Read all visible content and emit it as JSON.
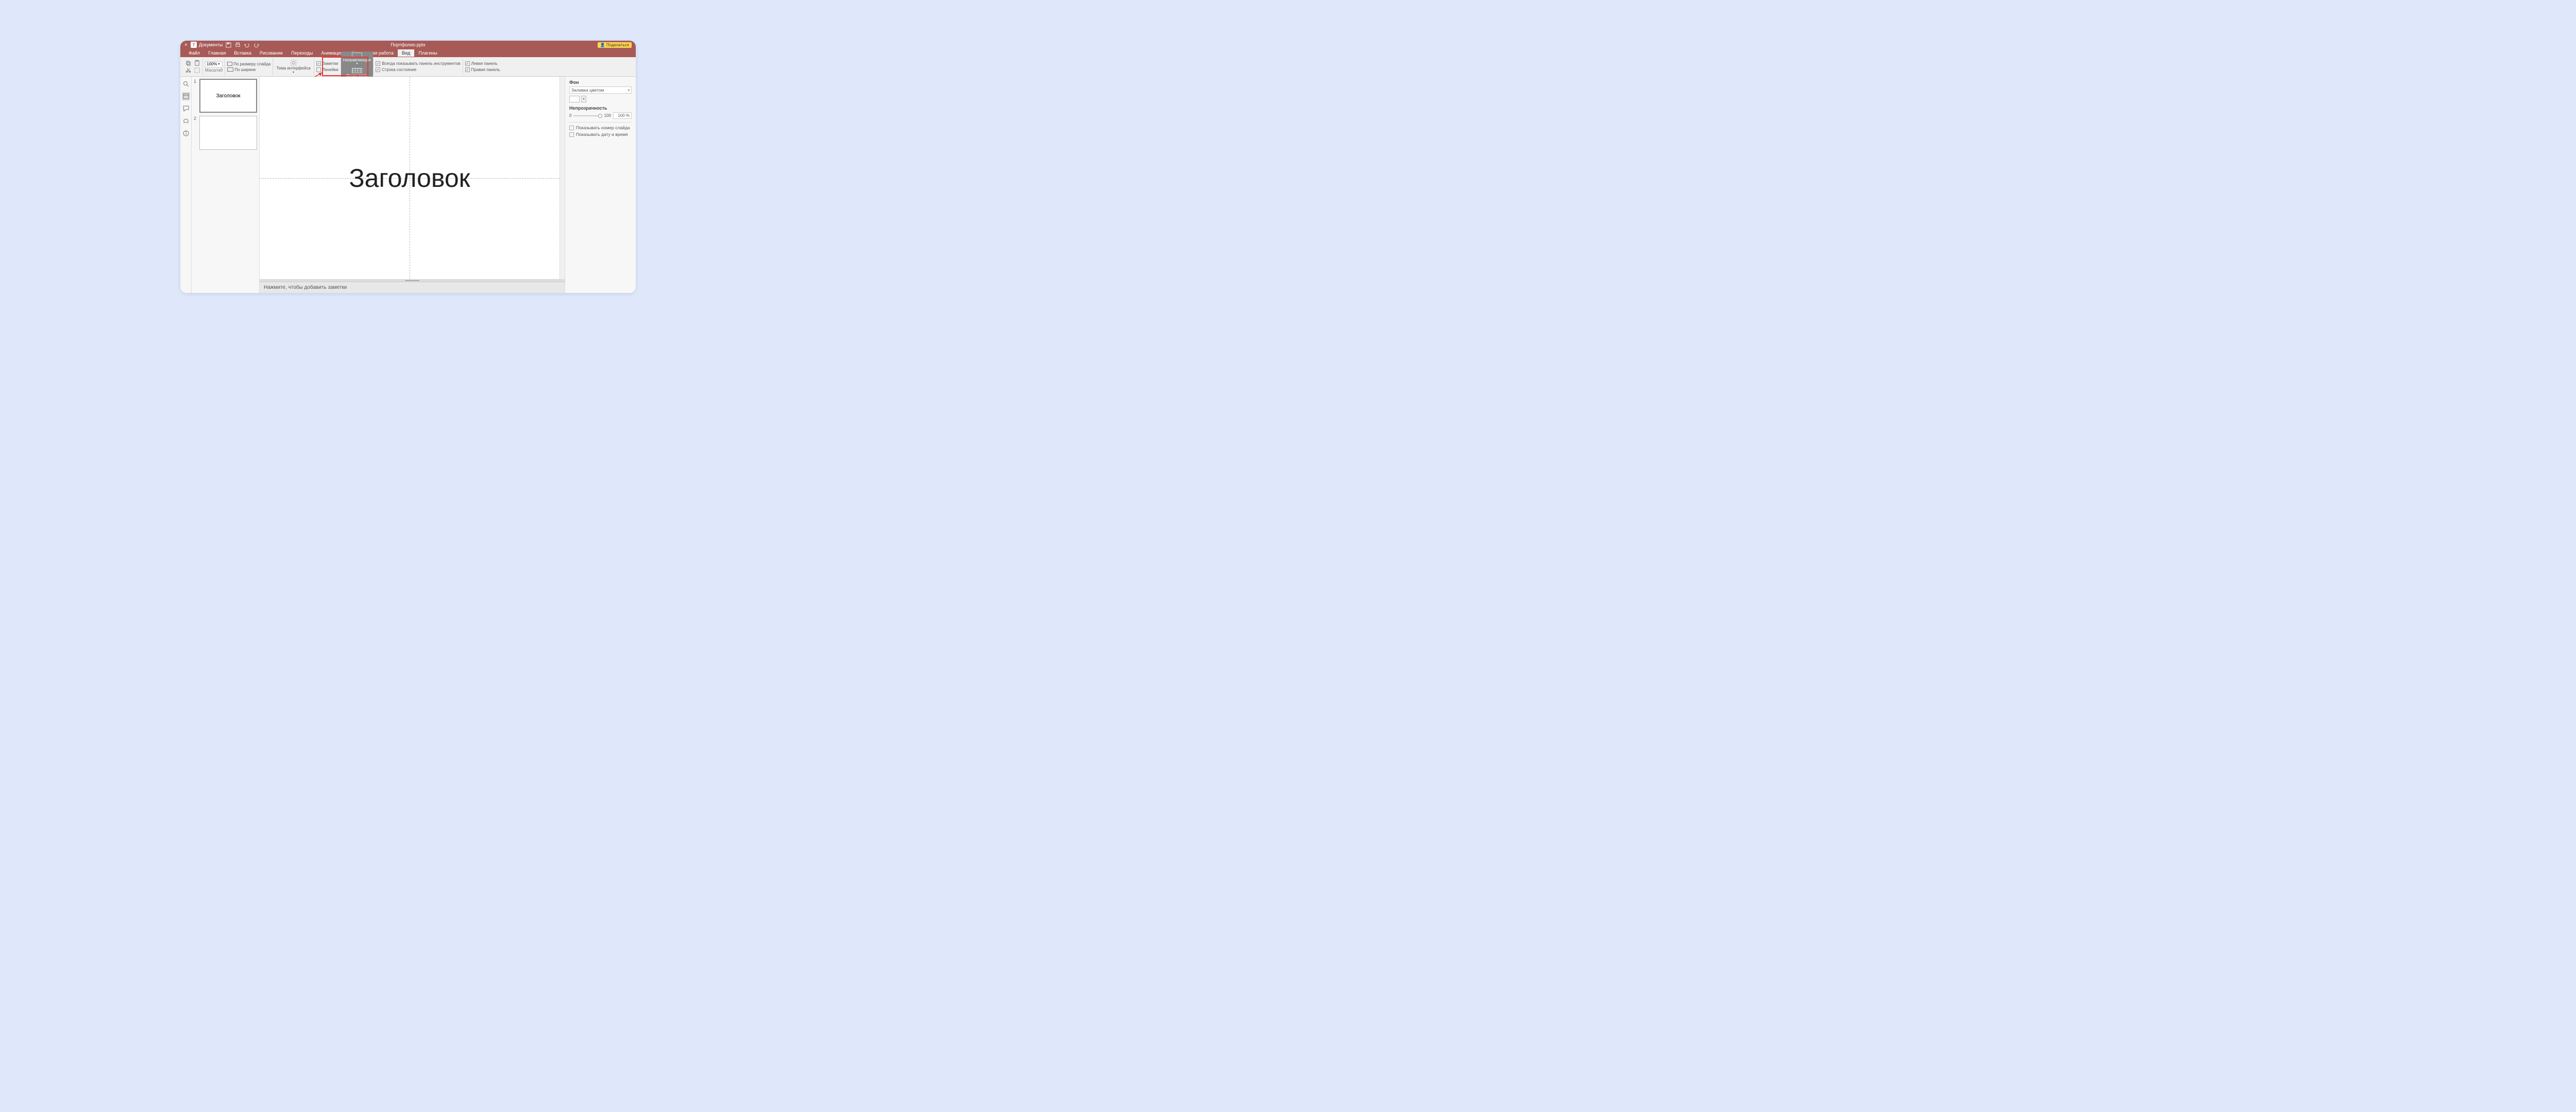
{
  "titlebar": {
    "app_name": "Документы",
    "doc_title": "Портфолио.pptx",
    "share": "Поделиться"
  },
  "menu": [
    "Файл",
    "Главная",
    "Вставка",
    "Рисование",
    "Переходы",
    "Анимация",
    "Совместная работа",
    "Вид",
    "Плагины"
  ],
  "menu_active_index": 7,
  "ribbon": {
    "zoom_value": "100%",
    "zoom_label": "Масштаб",
    "fit_slide": "По размеру слайда",
    "fit_width": "По ширине",
    "theme": "Тема интерфейса",
    "notes": "Заметки",
    "rulers": "Линейки",
    "guides": "Направляющие",
    "gridlines": "Линии сетки",
    "always_show_toolbar": "Всегда показывать панель инструментов",
    "status_bar": "Строка состояния",
    "left_panel": "Левая панель",
    "right_panel": "Правая панель"
  },
  "slides": {
    "items": [
      {
        "num": "1",
        "label": "Заголовок"
      },
      {
        "num": "2",
        "label": ""
      }
    ]
  },
  "canvas": {
    "title_text": "Заголовок"
  },
  "notes_placeholder": "Нажмите, чтобы добавить заметки",
  "rightpanel": {
    "bg_heading": "Фон",
    "fill_type": "Заливка цветом",
    "opacity_heading": "Непрозрачность",
    "opacity_min": "0",
    "opacity_max": "100",
    "opacity_value": "100 %",
    "show_slide_num": "Показывать номер слайда",
    "show_datetime": "Показывать дату и время"
  }
}
